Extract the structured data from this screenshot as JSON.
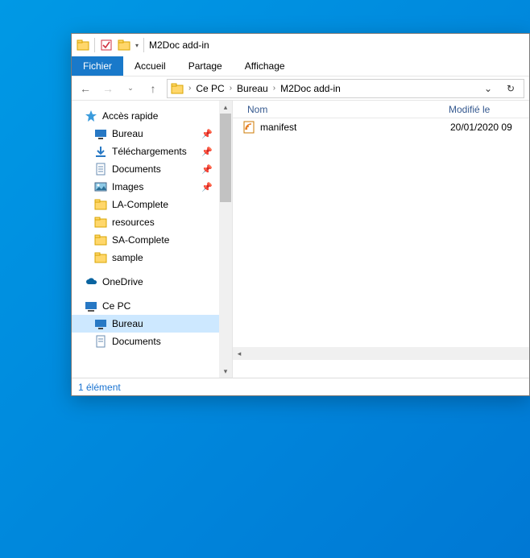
{
  "window": {
    "title": "M2Doc add-in"
  },
  "ribbon": {
    "tabs": [
      "Fichier",
      "Accueil",
      "Partage",
      "Affichage"
    ],
    "active": 0
  },
  "breadcrumbs": [
    "Ce PC",
    "Bureau",
    "M2Doc add-in"
  ],
  "nav": {
    "quickAccess": "Accès rapide",
    "items": [
      {
        "label": "Bureau",
        "icon": "desktop",
        "pinned": true
      },
      {
        "label": "Téléchargements",
        "icon": "download",
        "pinned": true
      },
      {
        "label": "Documents",
        "icon": "document",
        "pinned": true
      },
      {
        "label": "Images",
        "icon": "image",
        "pinned": true
      },
      {
        "label": "LA-Complete",
        "icon": "folder",
        "pinned": false
      },
      {
        "label": "resources",
        "icon": "folder",
        "pinned": false
      },
      {
        "label": "SA-Complete",
        "icon": "folder",
        "pinned": false
      },
      {
        "label": "sample",
        "icon": "folder",
        "pinned": false
      }
    ],
    "onedrive": "OneDrive",
    "thispc": "Ce PC",
    "thispc_children": [
      {
        "label": "Bureau",
        "icon": "desktop",
        "selected": true
      },
      {
        "label": "Documents",
        "icon": "document",
        "selected": false
      }
    ]
  },
  "columns": {
    "name": "Nom",
    "modified": "Modifié le"
  },
  "files": [
    {
      "name": "manifest",
      "modified": "20/01/2020 09",
      "icon": "xml"
    }
  ],
  "status": {
    "count": "1 élément"
  }
}
